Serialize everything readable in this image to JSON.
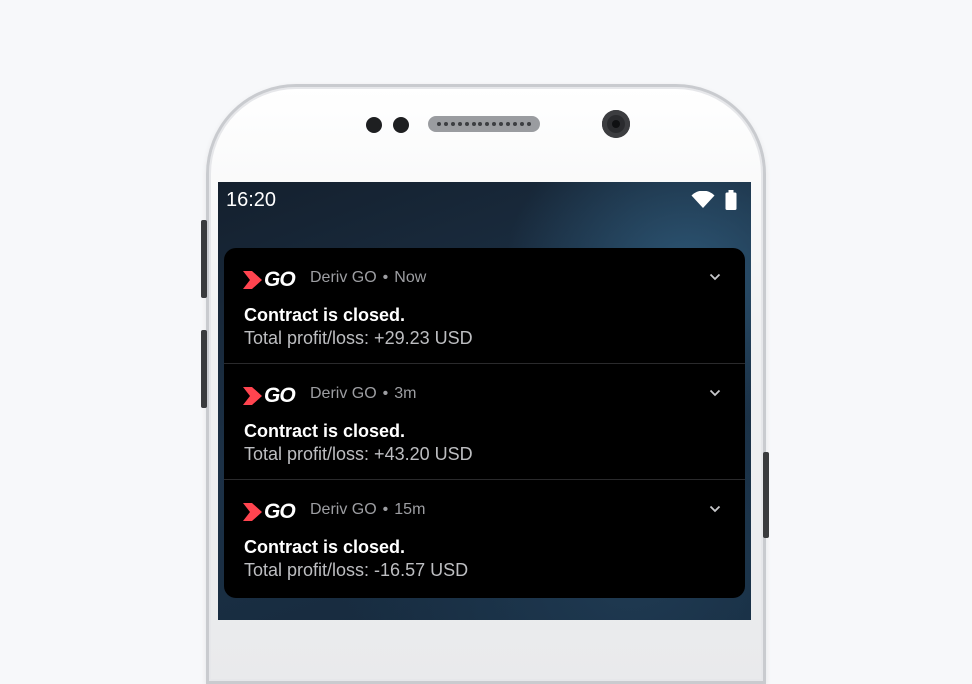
{
  "status_bar": {
    "time": "16:20",
    "icons": [
      "wifi-icon",
      "battery-icon"
    ]
  },
  "notifications": [
    {
      "app_name": "Deriv GO",
      "logo_text": "GO",
      "separator": "•",
      "time": "Now",
      "title": "Contract is closed.",
      "body": "Total profit/loss: +29.23 USD"
    },
    {
      "app_name": "Deriv GO",
      "logo_text": "GO",
      "separator": "•",
      "time": "3m",
      "title": "Contract is closed.",
      "body": "Total profit/loss: +43.20 USD"
    },
    {
      "app_name": "Deriv GO",
      "logo_text": "GO",
      "separator": "•",
      "time": "15m",
      "title": "Contract is closed.",
      "body": "Total profit/loss: -16.57 USD"
    }
  ],
  "colors": {
    "brand_red": "#ff444f",
    "panel_bg": "#000000",
    "secondary_text": "#9d9ea2"
  }
}
